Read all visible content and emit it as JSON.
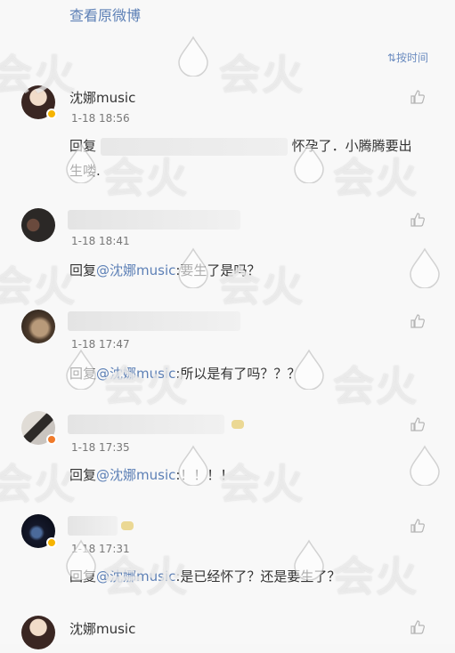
{
  "header": {
    "view_original": "查看原微博",
    "sort_label": "按时间"
  },
  "comments": [
    {
      "name": "沈娜music",
      "time": "1-18 18:56",
      "reply_prefix": "回复",
      "text_line1": "怀孕了．小腾腾要出",
      "text_line2": "生喽."
    },
    {
      "name": "",
      "time": "1-18 18:41",
      "reply_prefix": "回复",
      "mention": "@沈娜music",
      "text": ":要生了是吗？"
    },
    {
      "name": "",
      "time": "1-18 17:47",
      "reply_prefix": "回复",
      "mention": "@沈娜music",
      "text": ":所以是有了吗？？？"
    },
    {
      "name": "",
      "time": "1-18 17:35",
      "reply_prefix": "回复",
      "mention": "@沈娜music",
      "text": ":！！！！"
    },
    {
      "name": "",
      "time": "1-18 17:31",
      "reply_prefix": "回复",
      "mention": "@沈娜music",
      "text": ":是已经怀了？还是要生了？"
    },
    {
      "name": "沈娜music"
    }
  ],
  "watermark": {
    "text": "会火"
  },
  "colors": {
    "link": "#5d80b6",
    "badge_gold": "#f6b400",
    "badge_orange": "#f07a2a"
  }
}
